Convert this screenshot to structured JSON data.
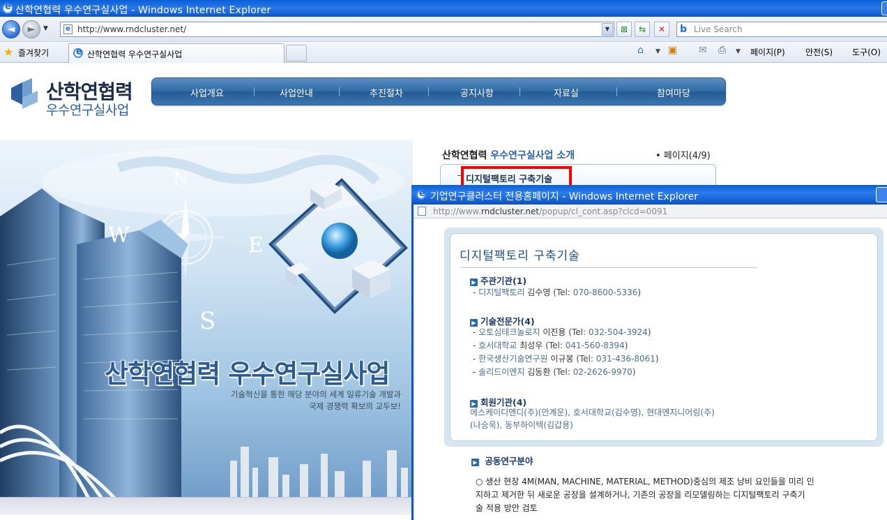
{
  "window": {
    "title": "산학연협력 우수연구실사업 - Windows Internet Explorer"
  },
  "toolbar": {
    "back_label": "◄",
    "forward_label": "►",
    "address_url": "http://www.rndcluster.net/",
    "search_placeholder": "Live Search"
  },
  "favorites_bar": {
    "favorites_label": "즐겨찾기",
    "tab_title": "산학연협력 우수연구실사업",
    "commands": [
      "페이지(P)",
      "안전(S)",
      "도구(O)"
    ]
  },
  "site": {
    "logo_line1": "산학연협력",
    "logo_line2": "우수연구실사업",
    "nav": [
      "사업개요",
      "사업안내",
      "추진절차",
      "공지사항",
      "자료실",
      "참여마당"
    ],
    "hero_title": "산학연협력 우수연구실사업",
    "hero_sub_line1": "기술혁신을 통한 해당 분야의 세계 일류기술 개발과",
    "hero_sub_line2": "국제 경쟁력 확보의 교두보!",
    "compass": [
      "N",
      "W",
      "E",
      "S"
    ],
    "intro_title_part1": "산학연협력 ",
    "intro_title_part2": "우수연구실사업 소개",
    "page_count": "• 페이지(4/9)",
    "intro_link": "디지털팩토리 구축기술"
  },
  "popup": {
    "title": "기업연구클러스터 전용홈페이지 - Windows Internet Explorer",
    "url_prefix": "http://www.",
    "url_domain": "rndcluster.net",
    "url_rest": "/popup/cl_cont.asp?clcd=0091",
    "heading": "디지털팩토리 구축기술",
    "sections": {
      "host": {
        "label": "주관기관(1)",
        "entries": [
          {
            "org": "디지털팩토리",
            "person": "김수영",
            "tel": "070-8600-5336"
          }
        ]
      },
      "experts": {
        "label": "기술전문가(4)",
        "entries": [
          {
            "org": "오토심테크놀로지",
            "person": "이진용",
            "tel": "032-504-3924"
          },
          {
            "org": "호서대학교",
            "person": "최성우",
            "tel": "041-560-8394"
          },
          {
            "org": "한국생산기술연구원",
            "person": "이규봉",
            "tel": "031-436-8061"
          },
          {
            "org": "솔리드이엔지",
            "person": "김동환",
            "tel": "02-2626-9970"
          }
        ]
      },
      "members": {
        "label": "회원기관(4)",
        "line1": "에스케이디앤디(주)(안계운), 호서대학교(김수영), 현대엔지니어링(주)",
        "line2": "(나승욱), 동부하이텍(김갑용)"
      }
    },
    "research_heading": "공동연구분야",
    "research_line1": "○ 생산 현장 4M(MAN, MACHINE, MATERIAL, METHOD)중심의 제조 낭비 요인들을 미리 인",
    "research_line2": "지하고 제거한 뒤 새로운 공장을 설계하거나, 기존의 공장을 리모델링하는 디지털팩토리 구축기",
    "research_line3": "술 적용 방안 검토"
  },
  "labels": {
    "tel_prefix": "(Tel: ",
    "tel_suffix": ")",
    "dash": "- "
  }
}
